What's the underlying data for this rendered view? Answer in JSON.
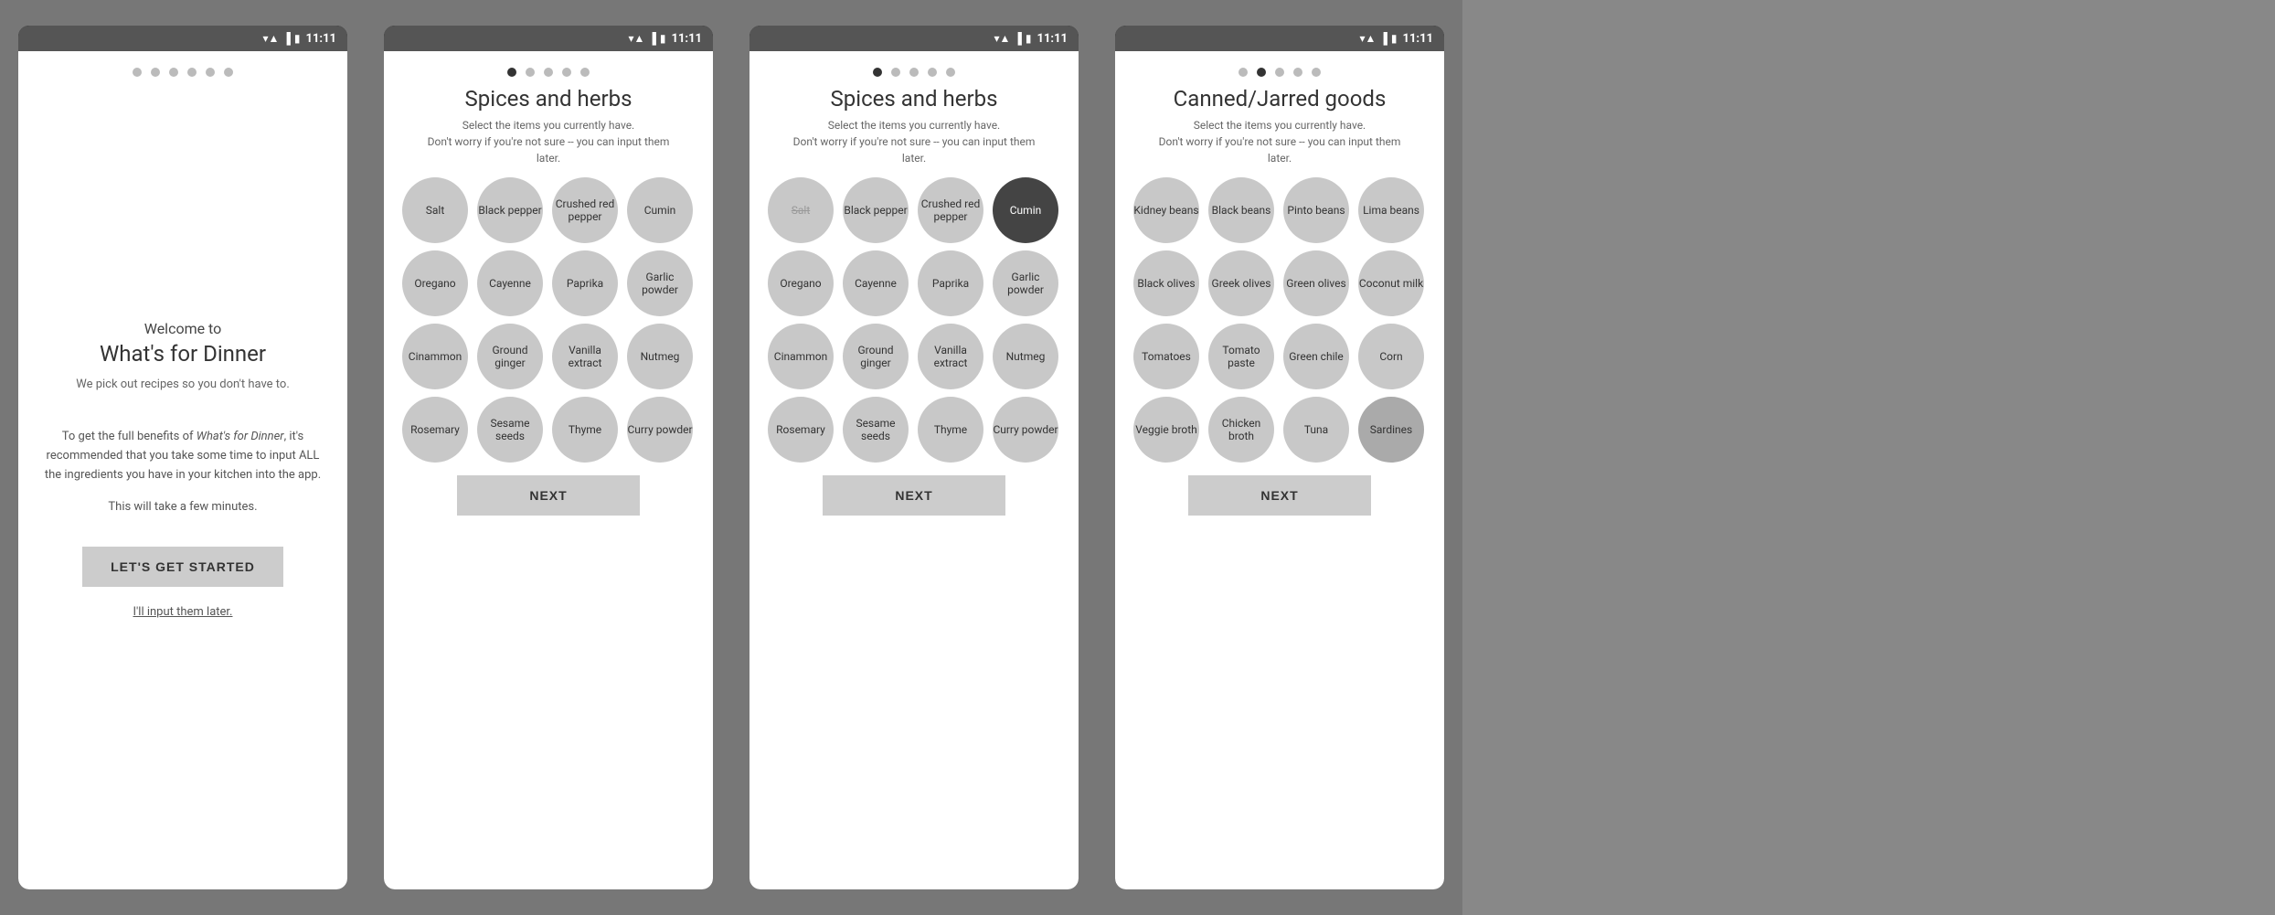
{
  "statusBar": {
    "time": "11:11"
  },
  "screen1": {
    "dots": [
      false,
      false,
      false,
      false,
      false,
      false
    ],
    "title_small": "Welcome to",
    "title_large": "What's for Dinner",
    "subtitle": "We pick out recipes so you don't have to.",
    "description": "To get the full benefits of What's for Dinner, it's recommended that you take some time to input ALL the ingredients you have in your kitchen into the app.",
    "note": "This will take a few minutes.",
    "cta_button": "LET'S GET STARTED",
    "skip_link": "I'll input them later."
  },
  "screen2": {
    "dots": [
      true,
      false,
      false,
      false,
      false
    ],
    "title": "Spices and herbs",
    "subtitle": "Select the items you currently have.\nDon't worry if you're not sure -- you can input them later.",
    "items": [
      {
        "label": "Salt",
        "selected": false
      },
      {
        "label": "Black pepper",
        "selected": false
      },
      {
        "label": "Crushed red pepper",
        "selected": false
      },
      {
        "label": "Cumin",
        "selected": false
      },
      {
        "label": "Oregano",
        "selected": false
      },
      {
        "label": "Cayenne",
        "selected": false
      },
      {
        "label": "Paprika",
        "selected": false
      },
      {
        "label": "Garlic powder",
        "selected": false
      },
      {
        "label": "Cinammon",
        "selected": false
      },
      {
        "label": "Ground ginger",
        "selected": false
      },
      {
        "label": "Vanilla extract",
        "selected": false
      },
      {
        "label": "Nutmeg",
        "selected": false
      },
      {
        "label": "Rosemary",
        "selected": false
      },
      {
        "label": "Sesame seeds",
        "selected": false
      },
      {
        "label": "Thyme",
        "selected": false
      },
      {
        "label": "Curry powder",
        "selected": false
      }
    ],
    "next_button": "NEXT"
  },
  "screen3": {
    "dots": [
      true,
      false,
      false,
      false,
      false
    ],
    "title": "Spices and herbs",
    "subtitle": "Select the items you currently have.\nDon't worry if you're not sure -- you can input them later.",
    "items": [
      {
        "label": "Salt",
        "selected": false,
        "strikethrough": true
      },
      {
        "label": "Black pepper",
        "selected": false
      },
      {
        "label": "Crushed red pepper",
        "selected": false
      },
      {
        "label": "Cumin",
        "selected": true
      },
      {
        "label": "Oregano",
        "selected": false
      },
      {
        "label": "Cayenne",
        "selected": false
      },
      {
        "label": "Paprika",
        "selected": false
      },
      {
        "label": "Garlic powder",
        "selected": false
      },
      {
        "label": "Cinammon",
        "selected": false
      },
      {
        "label": "Ground ginger",
        "selected": false
      },
      {
        "label": "Vanilla extract",
        "selected": false
      },
      {
        "label": "Nutmeg",
        "selected": false
      },
      {
        "label": "Rosemary",
        "selected": false
      },
      {
        "label": "Sesame seeds",
        "selected": false
      },
      {
        "label": "Thyme",
        "selected": false
      },
      {
        "label": "Curry powder",
        "selected": false
      }
    ],
    "next_button": "NEXT"
  },
  "screen4": {
    "dots": [
      false,
      true,
      false,
      false,
      false
    ],
    "title": "Canned/Jarred goods",
    "subtitle": "Select the items you currently have.\nDon't worry if you're not sure -- you can input them later.",
    "items": [
      {
        "label": "Kidney beans",
        "selected": false
      },
      {
        "label": "Black beans",
        "selected": false
      },
      {
        "label": "Pinto beans",
        "selected": false
      },
      {
        "label": "Lima beans",
        "selected": false
      },
      {
        "label": "Black olives",
        "selected": false
      },
      {
        "label": "Greek olives",
        "selected": false
      },
      {
        "label": "Green olives",
        "selected": false
      },
      {
        "label": "Coconut milk",
        "selected": false
      },
      {
        "label": "Tomatoes",
        "selected": false
      },
      {
        "label": "Tomato paste",
        "selected": false
      },
      {
        "label": "Green chile",
        "selected": false
      },
      {
        "label": "Corn",
        "selected": false
      },
      {
        "label": "Veggie broth",
        "selected": false
      },
      {
        "label": "Chicken broth",
        "selected": false
      },
      {
        "label": "Tuna",
        "selected": false
      },
      {
        "label": "Sardines",
        "selected": false
      }
    ],
    "next_button": "NEXT"
  }
}
